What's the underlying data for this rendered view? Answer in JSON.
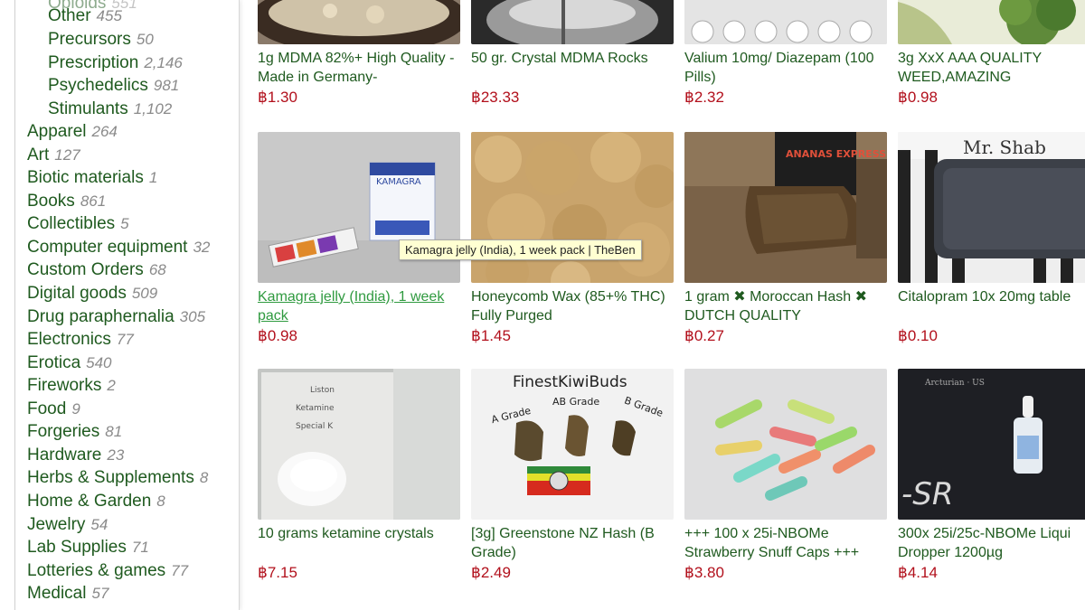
{
  "categories": [
    {
      "label": "Other",
      "count": "455",
      "level": "sub"
    },
    {
      "label": "Precursors",
      "count": "50",
      "level": "sub"
    },
    {
      "label": "Prescription",
      "count": "2,146",
      "level": "sub"
    },
    {
      "label": "Psychedelics",
      "count": "981",
      "level": "sub"
    },
    {
      "label": "Stimulants",
      "count": "1,102",
      "level": "sub"
    },
    {
      "label": "Apparel",
      "count": "264",
      "level": "top"
    },
    {
      "label": "Art",
      "count": "127",
      "level": "top"
    },
    {
      "label": "Biotic materials",
      "count": "1",
      "level": "top"
    },
    {
      "label": "Books",
      "count": "861",
      "level": "top"
    },
    {
      "label": "Collectibles",
      "count": "5",
      "level": "top"
    },
    {
      "label": "Computer equipment",
      "count": "32",
      "level": "top"
    },
    {
      "label": "Custom Orders",
      "count": "68",
      "level": "top"
    },
    {
      "label": "Digital goods",
      "count": "509",
      "level": "top"
    },
    {
      "label": "Drug paraphernalia",
      "count": "305",
      "level": "top"
    },
    {
      "label": "Electronics",
      "count": "77",
      "level": "top"
    },
    {
      "label": "Erotica",
      "count": "540",
      "level": "top"
    },
    {
      "label": "Fireworks",
      "count": "2",
      "level": "top"
    },
    {
      "label": "Food",
      "count": "9",
      "level": "top"
    },
    {
      "label": "Forgeries",
      "count": "81",
      "level": "top"
    },
    {
      "label": "Hardware",
      "count": "23",
      "level": "top"
    },
    {
      "label": "Herbs & Supplements",
      "count": "8",
      "level": "top"
    },
    {
      "label": "Home & Garden",
      "count": "8",
      "level": "top"
    },
    {
      "label": "Jewelry",
      "count": "54",
      "level": "top"
    },
    {
      "label": "Lab Supplies",
      "count": "71",
      "level": "top"
    },
    {
      "label": "Lotteries & games",
      "count": "77",
      "level": "top"
    },
    {
      "label": "Medical",
      "count": "57",
      "level": "top"
    }
  ],
  "listings": [
    {
      "title": "1g MDMA 82%+ High Quality -Made in Germany-",
      "price": "฿1.30",
      "image": "crystal-plate-photo"
    },
    {
      "title": "50 gr. Crystal MDMA Rocks",
      "price": "฿23.33",
      "image": "metal-bowl-photo"
    },
    {
      "title": "Valium 10mg/ Diazepam (100 Pills)",
      "price": "฿2.32",
      "image": "pill-blister-photo"
    },
    {
      "title": "3g XxX AAA QUALITY WEED,AMAZING",
      "price": "฿0.98",
      "image": "cannabis-bud-photo"
    },
    {
      "title": "Kamagra jelly (India), 1 week pack",
      "price": "฿0.98",
      "image": "kamagra-box-photo",
      "hovered": true
    },
    {
      "title": "Honeycomb Wax (85+% THC) Fully Purged",
      "price": "฿1.45",
      "image": "honeycomb-wax-photo"
    },
    {
      "title": "1 gram ✖ Moroccan Hash ✖ DUTCH QUALITY",
      "price": "฿0.27",
      "image": "hash-bar-photo",
      "box_text": "ANANAS EXPRESS"
    },
    {
      "title": "Citalopram 10x 20mg table",
      "price": "฿0.10",
      "image": "pill-pack-photo",
      "sign_text": "Mr. Shab"
    },
    {
      "title": "10 grams ketamine crystals",
      "price": "฿7.15",
      "image": "ketamine-bag-photo",
      "paper_lines": [
        "Liston",
        "Ketamine",
        "Special K"
      ]
    },
    {
      "title": "[3g] Greenstone NZ Hash (B Grade)",
      "price": "฿2.49",
      "image": "finestkiwibuds-photo",
      "sign_text": "FinestKiwiBuds",
      "grades": [
        "A Grade",
        "AB Grade",
        "B Grade"
      ]
    },
    {
      "title": "+++ 100 x 25i-NBOMe Strawberry Snuff Caps +++",
      "price": "฿3.80",
      "image": "capsules-photo"
    },
    {
      "title": "300x 25i/25c-NBOMe Liqui Dropper 1200µg",
      "price": "฿4.14",
      "image": "dropper-bottle-photo",
      "corner_text": "Arcturian · US",
      "overlay_text": "-SR"
    }
  ],
  "tooltip": "Kamagra jelly (India), 1 week pack | TheBen",
  "colors": {
    "category_link": "#1f5a1f",
    "count": "#8a8a8a",
    "price": "#b2101c",
    "hovered_link": "#2f9a3f",
    "tooltip_bg": "#ffffd2"
  }
}
